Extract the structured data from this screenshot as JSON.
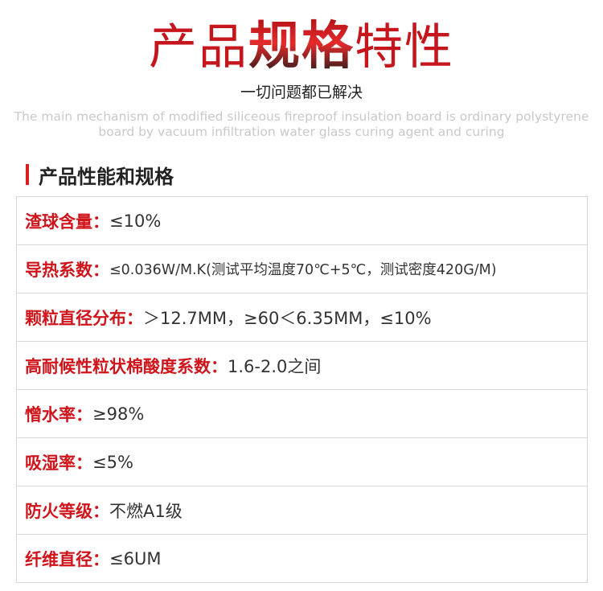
{
  "header": {
    "title_part1": "产品",
    "title_part2": "规格",
    "title_part3": "特性",
    "subtitle": "一切问题都已解决",
    "description": "The main mechanism of modified siliceous fireproof insulation board is ordinary polystyrene board by vacuum infiltration water glass curing agent and curing"
  },
  "section": {
    "title": "产品性能和规格"
  },
  "specs": [
    {
      "label": "渣球含量：",
      "value": "≤10%"
    },
    {
      "label": "导热系数：",
      "value": "≤0.036W/M.K(测试平均温度70℃+5℃，测试密度420G/M)"
    },
    {
      "label": "颗粒直径分布：",
      "value": "＞12.7MM，≥60＜6.35MM，≤10%"
    },
    {
      "label": "高耐候性粒状棉酸度系数：",
      "value": "1.6-2.0之间"
    },
    {
      "label": "憎水率：",
      "value": "≥98%"
    },
    {
      "label": "吸湿率：",
      "value": "≤5%"
    },
    {
      "label": "防火等级：",
      "value": "不燃A1级"
    },
    {
      "label": "纤维直径：",
      "value": "≤6UM"
    }
  ],
  "colors": {
    "accent": "#d0141b",
    "text": "#333333",
    "border": "#d6d6d6",
    "desc": "#c9c9c9"
  }
}
